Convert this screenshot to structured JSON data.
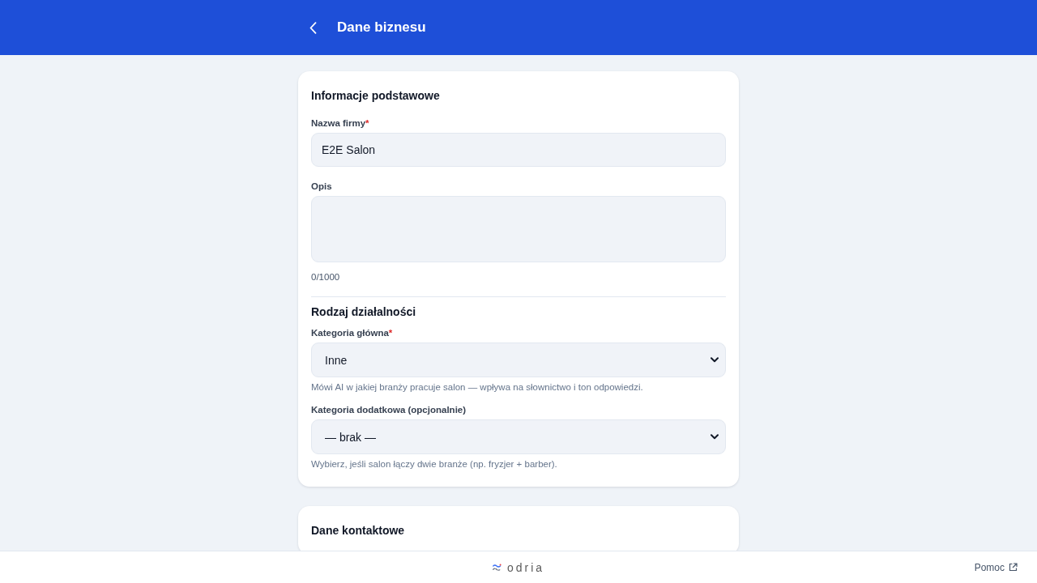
{
  "header": {
    "title": "Dane biznesu"
  },
  "sections": [
    {
      "title": "Informacje podstawowe",
      "groups": [
        {
          "fields": [
            {
              "kind": "text",
              "label": "Nazwa firmy",
              "required_mark": "*",
              "value": "E2E Salon"
            },
            {
              "kind": "textarea",
              "label": "Opis",
              "counter": "0/1000"
            }
          ]
        },
        {
          "heading": "Rodzaj działalności",
          "fields": [
            {
              "kind": "select",
              "label": "Kategoria główna",
              "required_mark": "*",
              "value": "Inne",
              "hint": "Mówi AI w jakiej branży pracuje salon — wpływa na słownictwo i ton odpowiedzi."
            },
            {
              "kind": "select",
              "label": "Kategoria dodatkowa (opcjonalnie)",
              "value": "— brak —",
              "hint": "Wybierz, jeśli salon łączy dwie branże (np. fryzjer + barber)."
            }
          ]
        }
      ]
    },
    {
      "title": "Dane kontaktowe"
    }
  ],
  "footer": {
    "logo": "odria",
    "help_link": "Pomoc"
  }
}
